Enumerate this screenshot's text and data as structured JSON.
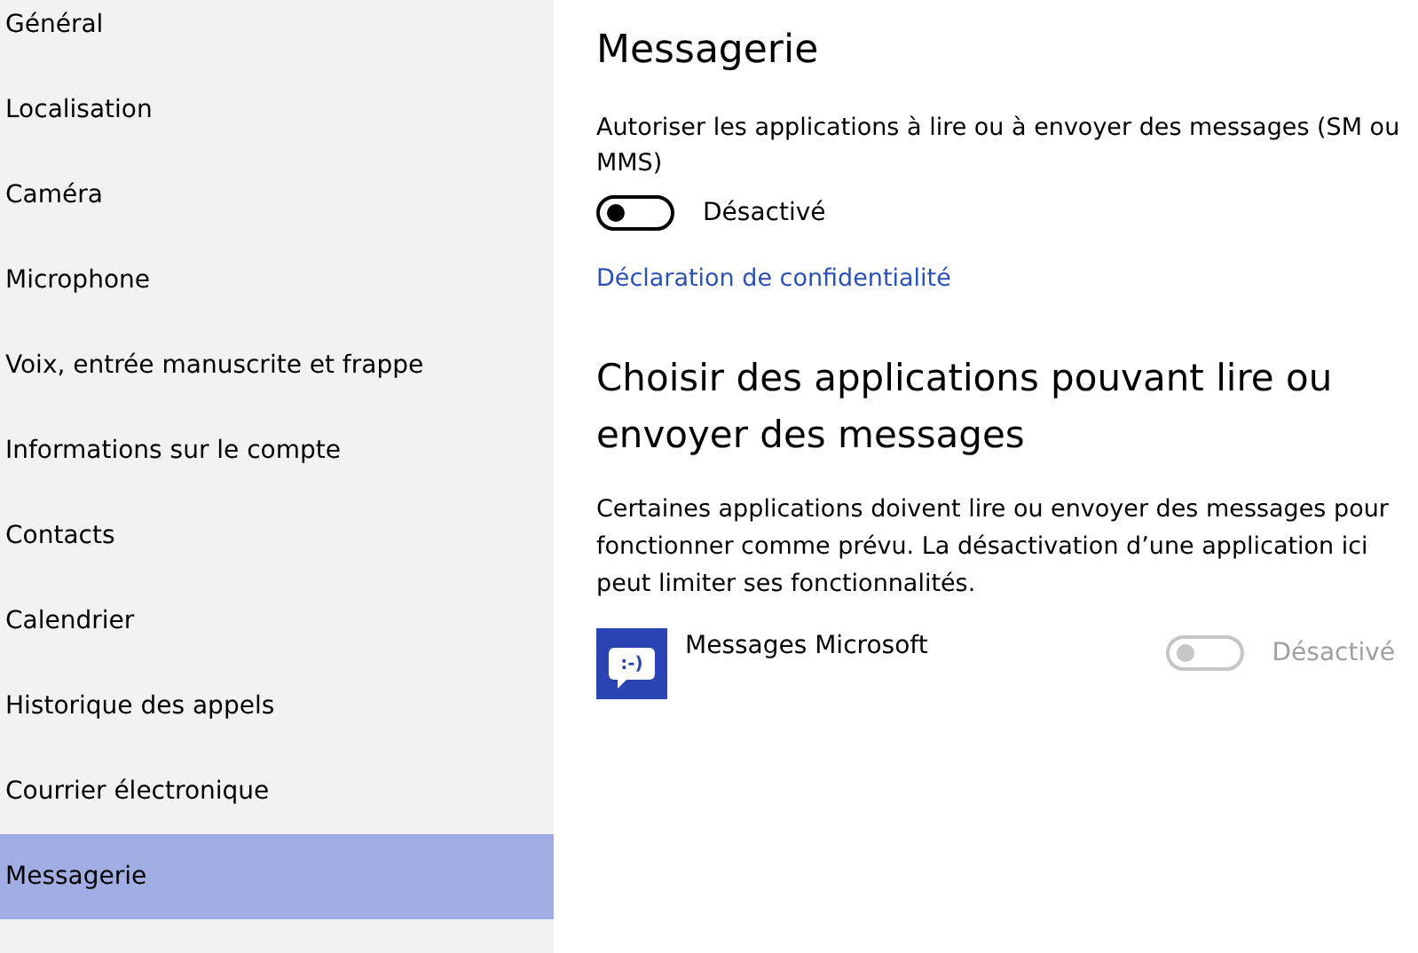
{
  "sidebar": {
    "items": [
      {
        "label": "Général",
        "selected": false
      },
      {
        "label": "Localisation",
        "selected": false
      },
      {
        "label": "Caméra",
        "selected": false
      },
      {
        "label": "Microphone",
        "selected": false
      },
      {
        "label": "Voix, entrée manuscrite et frappe",
        "selected": false
      },
      {
        "label": "Informations sur le compte",
        "selected": false
      },
      {
        "label": "Contacts",
        "selected": false
      },
      {
        "label": "Calendrier",
        "selected": false
      },
      {
        "label": "Historique des appels",
        "selected": false
      },
      {
        "label": "Courrier électronique",
        "selected": false
      },
      {
        "label": "Messagerie",
        "selected": true
      }
    ]
  },
  "page_title": "Messagerie",
  "permission": {
    "description": "Autoriser les applications à lire ou à envoyer des messages (SM ou MMS)",
    "toggle": {
      "on": false,
      "disabled": false,
      "label": "Désactivé"
    }
  },
  "privacy_link": "Déclaration de confidentialité",
  "apps_section": {
    "heading": "Choisir des applications pouvant lire ou envoyer des messages",
    "description": "Certaines applications doivent lire ou envoyer des messages pour fonctionner comme prévu. La désactivation d’une application ici peut limiter ses fonctionnalités.",
    "apps": [
      {
        "name": "Messages Microsoft",
        "icon_text": ":-)",
        "toggle": {
          "on": false,
          "disabled": true,
          "label": "Désactivé"
        }
      }
    ]
  }
}
